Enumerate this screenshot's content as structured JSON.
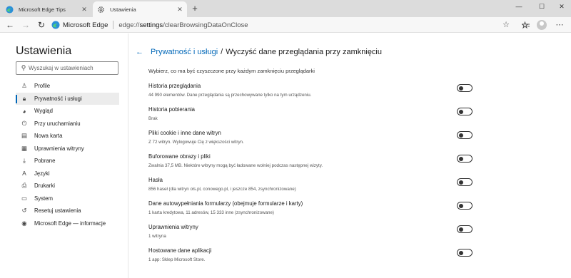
{
  "tabs": [
    {
      "title": "Microsoft Edge Tips",
      "close": "✕"
    },
    {
      "title": "Ustawienia",
      "close": "✕"
    }
  ],
  "new_tab": "+",
  "window_controls": {
    "minimize": "—",
    "maximize": "☐",
    "close": "✕"
  },
  "toolbar": {
    "back": "←",
    "forward": "→",
    "refresh": "↻",
    "brand": "Microsoft Edge",
    "url_scheme": "edge://",
    "url_host": "settings",
    "url_path": "/clearBrowsingDataOnClose",
    "star": "☆",
    "favorites": "⭐",
    "more": "⋯"
  },
  "sidebar": {
    "title": "Ustawienia",
    "search_placeholder": "Wyszukaj w ustawieniach",
    "items": [
      {
        "label": "Profile",
        "icon": "person-icon",
        "glyph": "♙"
      },
      {
        "label": "Prywatność i usługi",
        "icon": "lock-icon",
        "glyph": "🔒︎"
      },
      {
        "label": "Wygląd",
        "icon": "palette-icon",
        "glyph": "◕"
      },
      {
        "label": "Przy uruchamianiu",
        "icon": "power-icon",
        "glyph": "⏻"
      },
      {
        "label": "Nowa karta",
        "icon": "newtab-icon",
        "glyph": "▤"
      },
      {
        "label": "Uprawnienia witryny",
        "icon": "site-permissions-icon",
        "glyph": "▦"
      },
      {
        "label": "Pobrane",
        "icon": "download-icon",
        "glyph": "⤓"
      },
      {
        "label": "Języki",
        "icon": "language-icon",
        "glyph": "A"
      },
      {
        "label": "Drukarki",
        "icon": "printer-icon",
        "glyph": "⎙"
      },
      {
        "label": "System",
        "icon": "laptop-icon",
        "glyph": "▭"
      },
      {
        "label": "Resetuj ustawienia",
        "icon": "reset-icon",
        "glyph": "↺"
      },
      {
        "label": "Microsoft Edge — informacje",
        "icon": "edge-icon",
        "glyph": "◉"
      }
    ],
    "active_index": 1
  },
  "main": {
    "back_arrow": "←",
    "breadcrumb_parent": "Prywatność i usługi",
    "breadcrumb_sep": "/",
    "breadcrumb_current": "Wyczyść dane przeglądania przy zamknięciu",
    "subtitle": "Wybierz, co ma być czyszczone przy każdym zamknięciu przeglądarki",
    "rows": [
      {
        "title": "Historia przeglądania",
        "desc": "44 990 elementów. Dane przeglądania są przechowywane tylko na tym urządzeniu.",
        "on": false
      },
      {
        "title": "Historia pobierania",
        "desc": "Brak",
        "on": false
      },
      {
        "title": "Pliki cookie i inne dane witryn",
        "desc": "Z 72 witryn. Wylogowuje Cię z większości witryn.",
        "on": false
      },
      {
        "title": "Buforowane obrazy i pliki",
        "desc": "Zwalnia 37,5 MB. Niektóre witryny mogą być ładowane wolniej podczas następnej wizyty.",
        "on": false
      },
      {
        "title": "Hasła",
        "desc": "856 haseł (dla witryn ols.pl, conowego.pl, i jeszcze 854, zsynchronizowane)",
        "on": false
      },
      {
        "title": "Dane autowypełniania formularzy (obejmuje formularze i karty)",
        "desc": "1 karta kredytowa, 11 adresów, 15 333 inne (zsynchronizowane)",
        "on": false
      },
      {
        "title": "Uprawnienia witryny",
        "desc": "1 witryna",
        "on": false
      },
      {
        "title": "Hostowane dane aplikacji",
        "desc": "1 app: Sklep Microsoft Store.",
        "on": false
      }
    ]
  },
  "colors": {
    "accent": "#0067b8",
    "tabstrip": "#dcdcdc"
  }
}
